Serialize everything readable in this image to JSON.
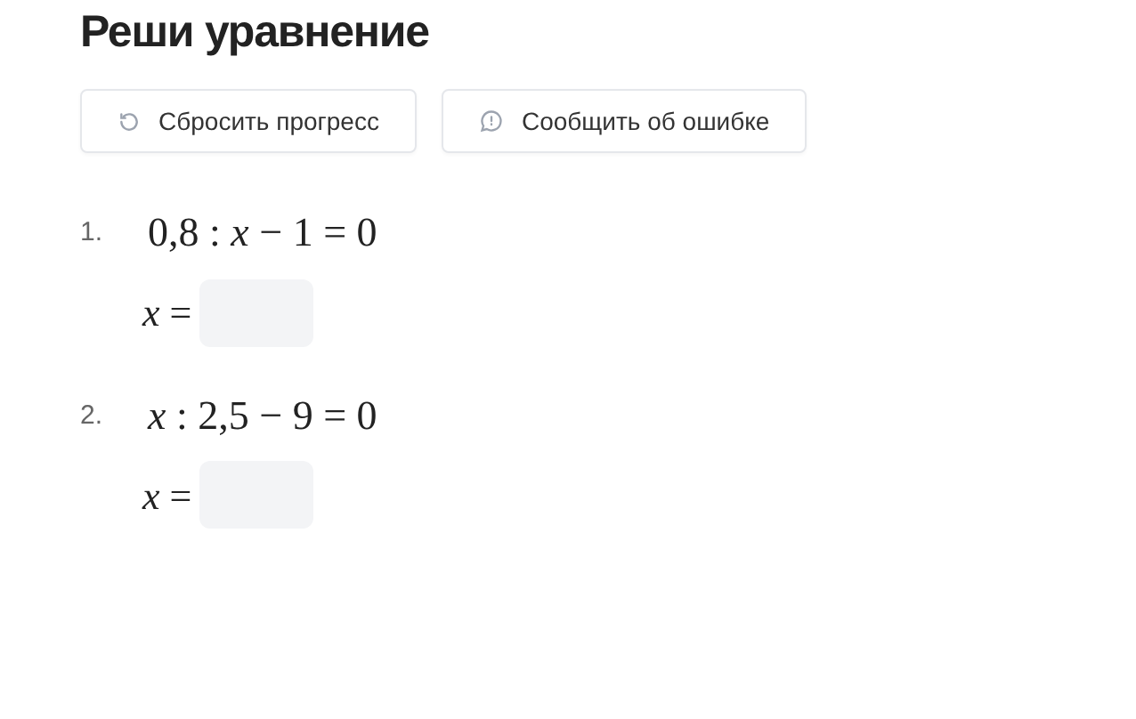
{
  "title": "Реши уравнение",
  "buttons": [
    {
      "kind": "reset",
      "label": "Сбросить прогресс"
    },
    {
      "kind": "report",
      "label": "Сообщить об ошибке"
    }
  ],
  "tasks": [
    {
      "number": "1.",
      "equation": "0,8 : *x* − 1 = 0",
      "answer_label": "*x* ="
    },
    {
      "number": "2.",
      "equation": "*x* : 2,5 − 9 = 0",
      "answer_label": "*x* ="
    }
  ]
}
